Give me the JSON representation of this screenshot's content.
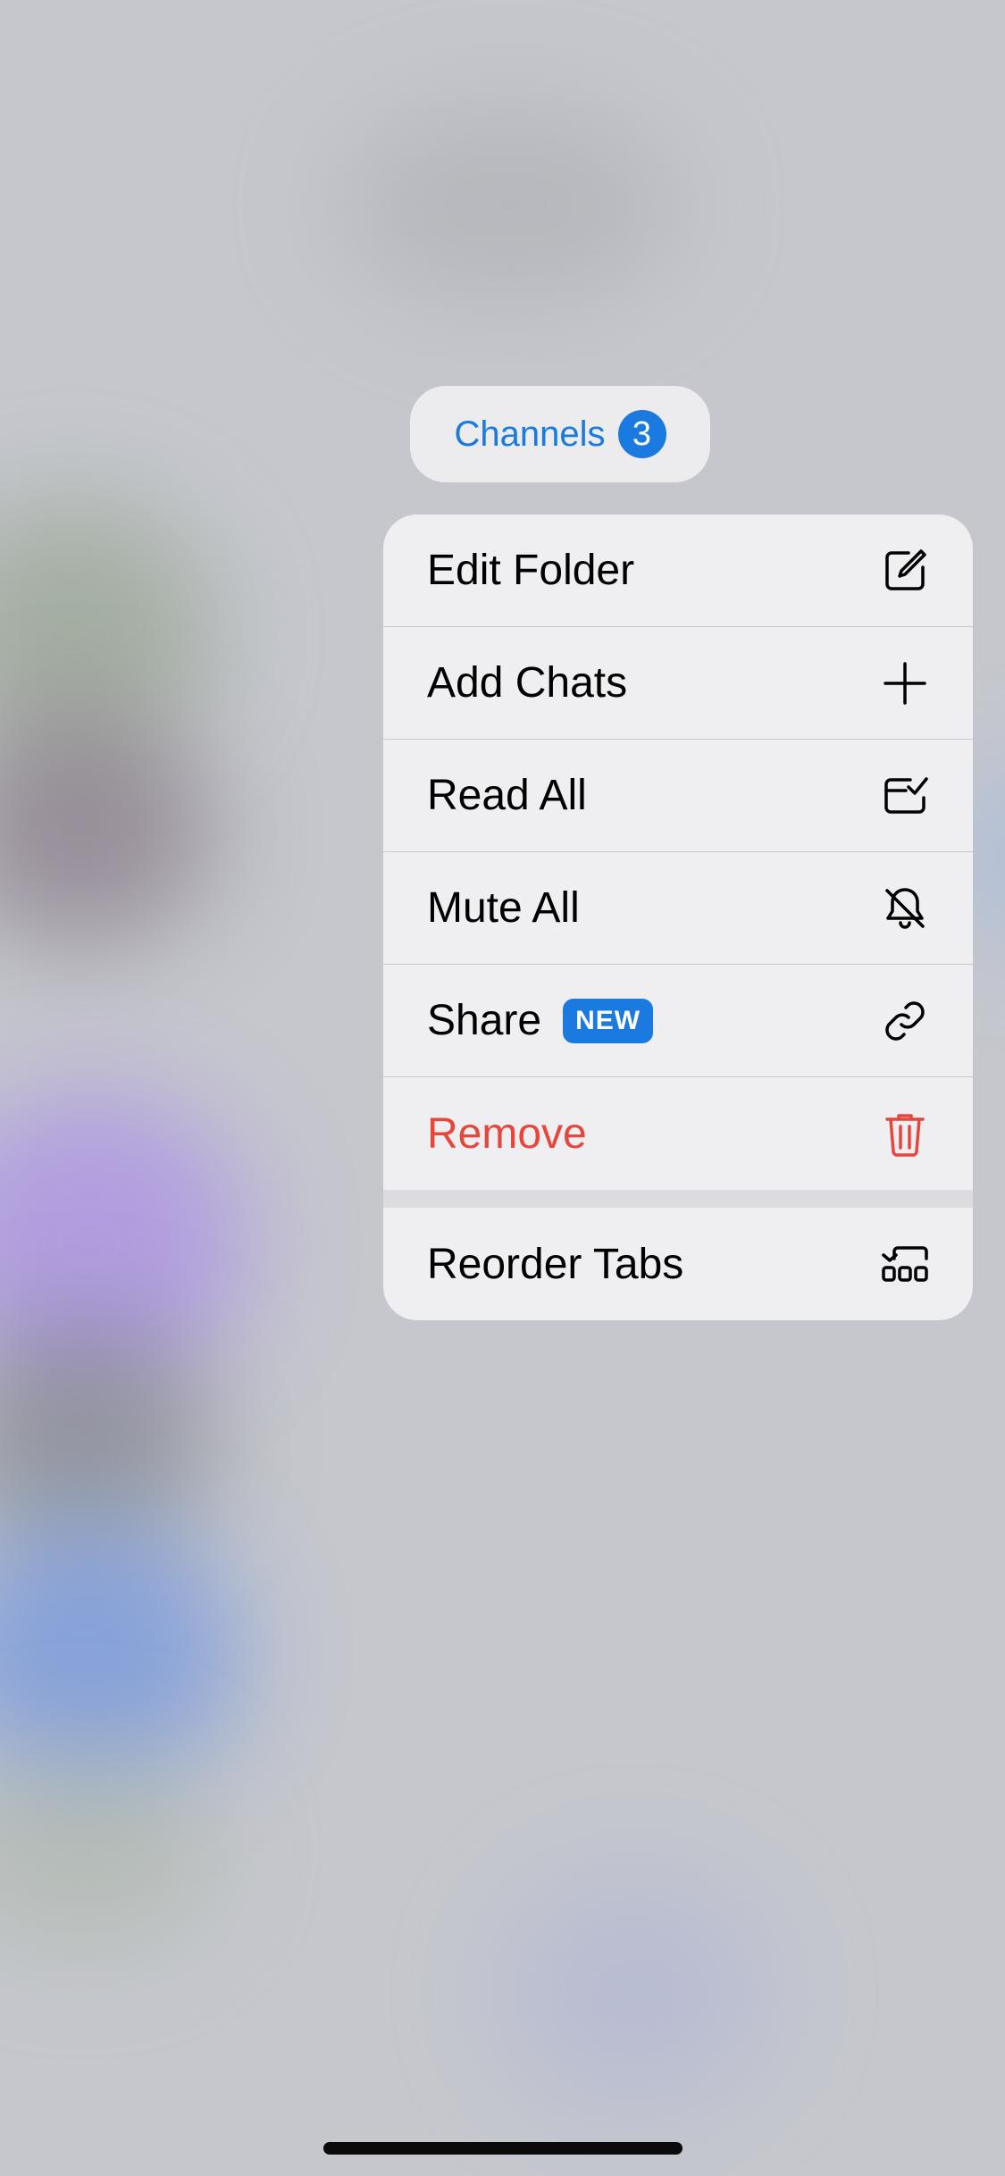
{
  "folder_tab": {
    "label": "Channels",
    "badge": "3"
  },
  "menu": {
    "items": [
      {
        "label": "Edit Folder",
        "icon": "edit-icon"
      },
      {
        "label": "Add Chats",
        "icon": "plus-icon"
      },
      {
        "label": "Read All",
        "icon": "read-all-icon"
      },
      {
        "label": "Mute All",
        "icon": "bell-slash-icon"
      },
      {
        "label": "Share",
        "badge": "NEW",
        "icon": "link-icon"
      },
      {
        "label": "Remove",
        "icon": "trash-icon",
        "color": "#e8453c"
      }
    ],
    "secondary": {
      "label": "Reorder Tabs",
      "icon": "reorder-tabs-icon"
    }
  },
  "colors": {
    "accent": "#1a7ae0",
    "danger": "#e8453c"
  }
}
